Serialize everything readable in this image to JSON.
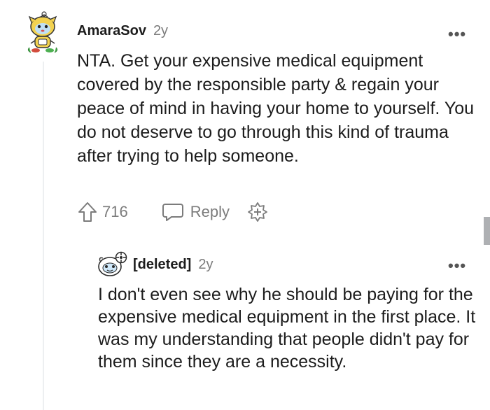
{
  "top_comment": {
    "author": "AmaraSov",
    "age": "2y",
    "more_label": "•••",
    "body": "NTA. Get your expensive medical equipment covered by the responsible party & regain your peace of mind in having your home to yourself. You do not deserve to go through this kind of trauma after trying to help someone.",
    "votes": "716",
    "reply_label": "Reply",
    "icons": [
      "upvote-icon",
      "comment-bubble-icon",
      "add-award-icon",
      "more-options-icon"
    ]
  },
  "reply_comment": {
    "author": "[deleted]",
    "age": "2y",
    "more_label": "•••",
    "body": "I don't even see why he should be paying for the expensive medical equipment in the first place. It was my understanding that people didn't pay for them since they are a necessity."
  },
  "colors": {
    "text": "#1c1c1c",
    "muted": "#7c7c7c",
    "thread_line": "#edeff1",
    "scroll_thumb": "#aeb0b3"
  }
}
